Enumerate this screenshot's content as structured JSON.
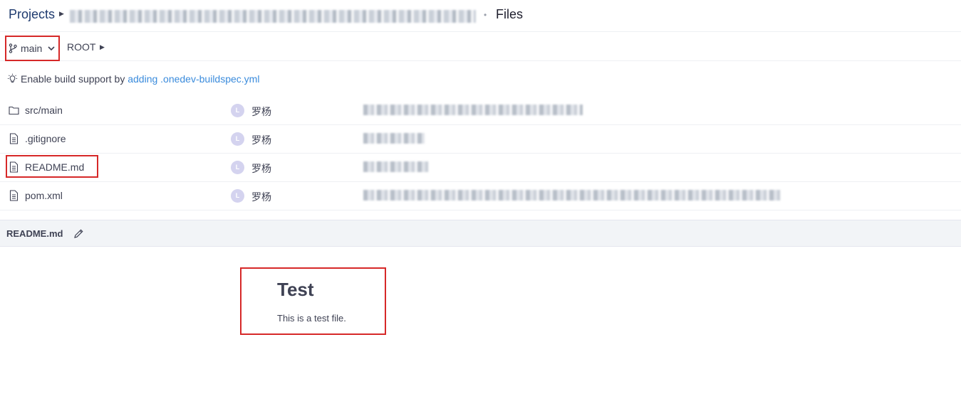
{
  "breadcrumb": {
    "projects_label": "Projects",
    "current_label": "Files"
  },
  "branchbar": {
    "branch_label": "main",
    "path_root": "ROOT"
  },
  "build_support": {
    "prefix": "Enable build support by",
    "link_text": "adding .onedev-buildspec.yml"
  },
  "files": [
    {
      "name": "src/main",
      "icon": "folder-icon",
      "author": "罗杨",
      "avatar_letter": "L"
    },
    {
      "name": ".gitignore",
      "icon": "file-icon",
      "author": "罗杨",
      "avatar_letter": "L"
    },
    {
      "name": "README.md",
      "icon": "file-icon",
      "author": "罗杨",
      "avatar_letter": "L"
    },
    {
      "name": "pom.xml",
      "icon": "file-icon",
      "author": "罗杨",
      "avatar_letter": "L"
    }
  ],
  "readme": {
    "filename": "README.md",
    "heading": "Test",
    "body": "This is a test file."
  },
  "colors": {
    "link": "#3a8bdc",
    "highlight_border": "#d62828",
    "avatar_bg": "#d4d3ef",
    "projects_link": "#1e3a6e"
  }
}
